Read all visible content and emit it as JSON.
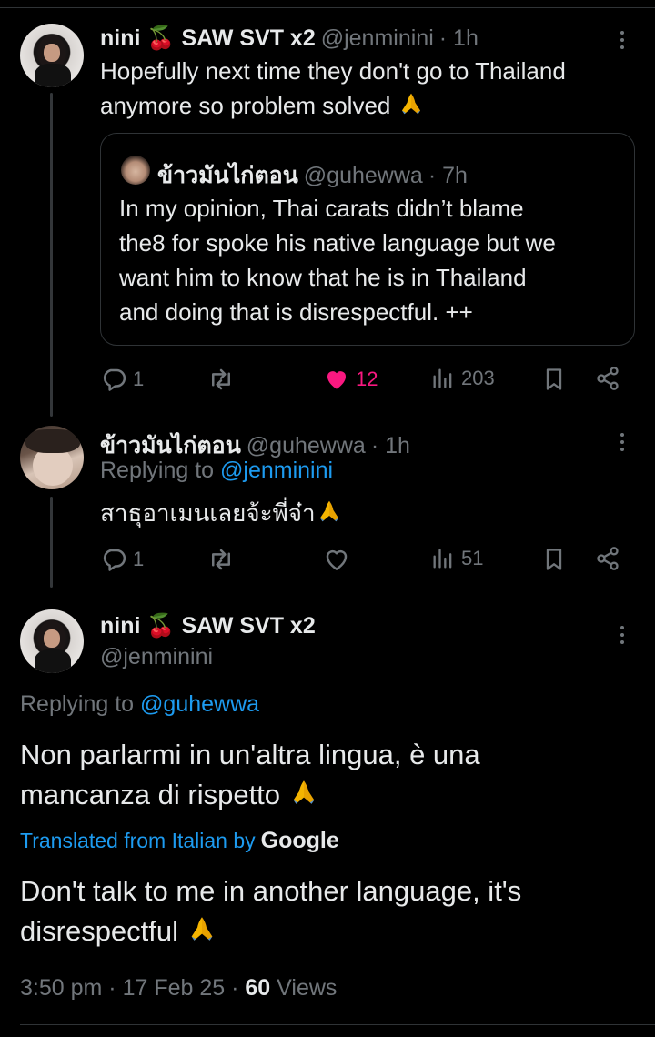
{
  "tweets": [
    {
      "name": "nini 🍒 SAW SVT x2",
      "handle": "@jenminini",
      "time": "· 1h",
      "text_line1": "Hopefully next time they don't go to Thailand",
      "text_line2": "anymore so problem solved",
      "quote": {
        "name": "ข้าวมันไก่ตอน",
        "handle": "@guhewwa",
        "time": "· 7h",
        "lines": [
          "In my opinion, Thai carats didn’t blame",
          "the8 for spoke his native language but we",
          "want him to know that he is in Thailand",
          "and doing that is disrespectful. ++"
        ]
      },
      "stats": {
        "replies": "1",
        "likes": "12",
        "views": "203"
      }
    },
    {
      "name": "ข้าวมันไก่ตอน",
      "handle": "@guhewwa",
      "time": "· 1h",
      "replying_prefix": "Replying to",
      "replying_to": "@jenminini",
      "text": "สาธุอาเมนเลยจ้ะพี่จ๋า",
      "stats": {
        "replies": "1",
        "views": "51"
      }
    }
  ],
  "main": {
    "name": "nini 🍒 SAW SVT x2",
    "handle": "@jenminini",
    "replying_prefix": "Replying to",
    "replying_to": "@guhewwa",
    "text_line1": "Non parlarmi in un'altra lingua, è una",
    "text_line2": "mancanza di rispetto",
    "translated_label": "Translated from Italian by",
    "translator": "Google",
    "translation_line1": "Don't talk to me in another language, it's",
    "translation_line2": "disrespectful",
    "time": "3:50 pm",
    "date": "17 Feb 25",
    "views_count": "60",
    "views_label": "Views"
  },
  "colors": {
    "like": "#f91880",
    "link": "#1d9bf0",
    "muted": "#71767b"
  },
  "icons": [
    "more-icon",
    "reply-icon",
    "retweet-icon",
    "like-icon",
    "views-icon",
    "bookmark-icon",
    "share-icon",
    "pray-emoji-icon"
  ]
}
